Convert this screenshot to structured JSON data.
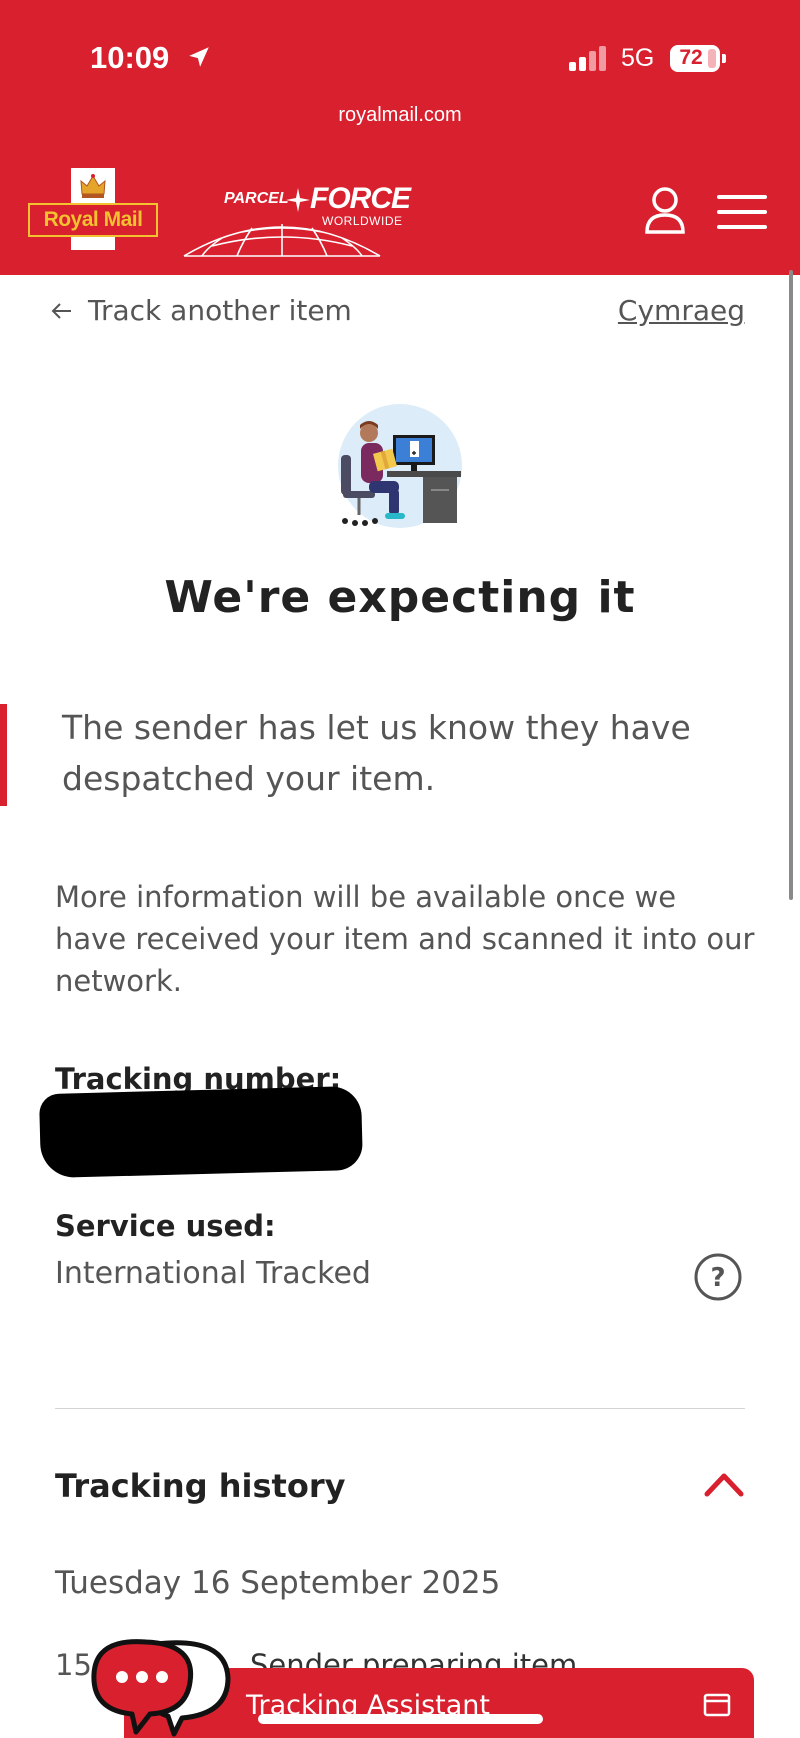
{
  "status_bar": {
    "time": "10:09",
    "network": "5G",
    "battery": "72"
  },
  "browser": {
    "url": "royalmail.com"
  },
  "header": {
    "royal_mail_logo_text": "Royal Mail",
    "parcelforce_logo_text_1": "PARCEL",
    "parcelforce_logo_text_2": "FORCE",
    "parcelforce_logo_text_3": "WORLDWIDE",
    "brand_color": "#d8202e"
  },
  "nav": {
    "back_label": "Track another item",
    "language_label": "Cymraeg"
  },
  "status": {
    "headline": "We're expecting it",
    "callout": "The sender has let us know they have despatched your item.",
    "info": "More information will be available once we have received your item and scanned it into our network."
  },
  "details": {
    "tracking_label": "Tracking number:",
    "service_label": "Service used:",
    "service_value": "International Tracked"
  },
  "history": {
    "title": "Tracking history",
    "date": "Tuesday 16 September 2025",
    "event_time": "15",
    "event_description": "Sender preparing item"
  },
  "assistant": {
    "label": "Tracking Assistant"
  }
}
